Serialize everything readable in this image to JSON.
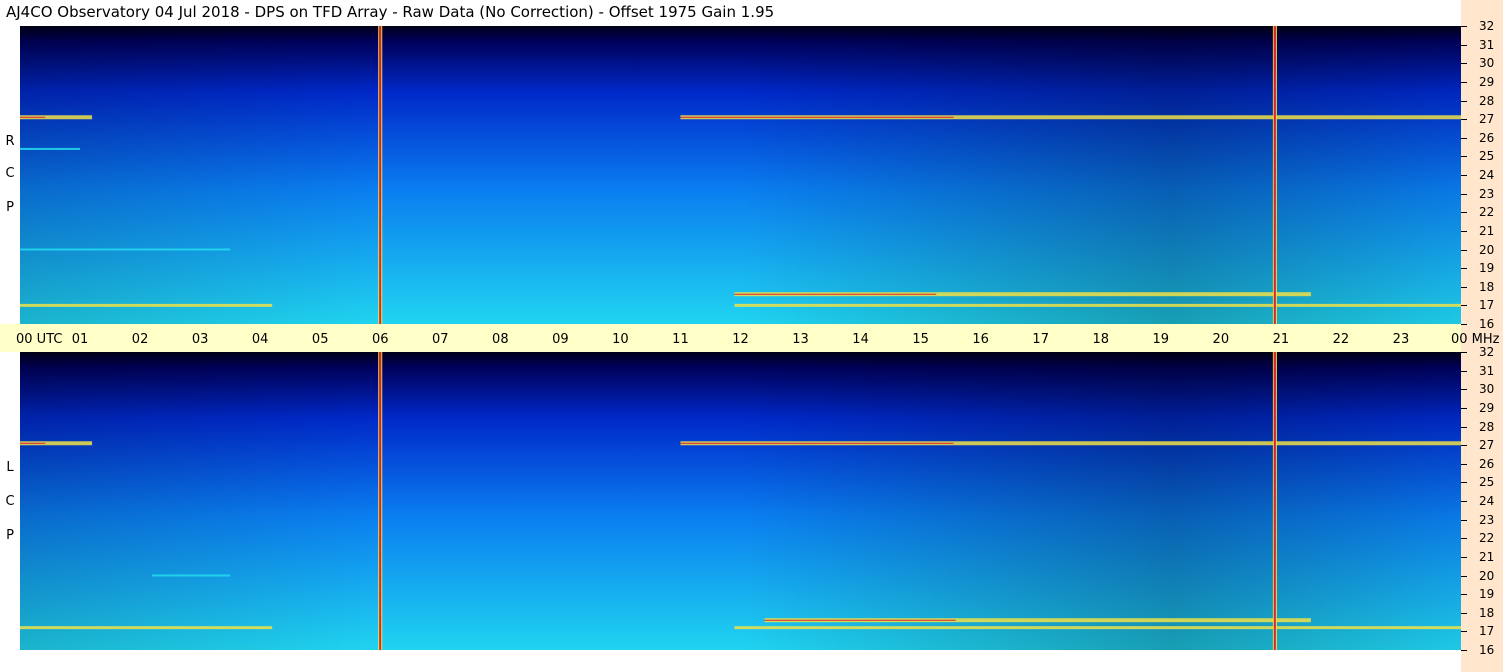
{
  "title": "AJ4CO Observatory  04 Jul 2018  -  DPS on TFD Array  -  Raw Data (No Correction)  -  Offset 1975  Gain 1.95",
  "panels": {
    "top_label": [
      "R",
      "C",
      "P"
    ],
    "bottom_label": [
      "L",
      "C",
      "P"
    ]
  },
  "x_axis": {
    "labels": [
      "00 UTC",
      "01",
      "02",
      "03",
      "04",
      "05",
      "06",
      "07",
      "08",
      "09",
      "10",
      "11",
      "12",
      "13",
      "14",
      "15",
      "16",
      "17",
      "18",
      "19",
      "20",
      "21",
      "22",
      "23",
      "00 MHz"
    ]
  },
  "y_axis": {
    "labels": [
      "32",
      "31",
      "30",
      "29",
      "28",
      "27",
      "26",
      "25",
      "24",
      "23",
      "22",
      "21",
      "20",
      "19",
      "18",
      "17",
      "16"
    ]
  },
  "chart_data": [
    {
      "type": "heatmap",
      "title": "RCP",
      "xlabel": "UTC",
      "ylabel": "MHz",
      "xlim": [
        0,
        24
      ],
      "ylim": [
        16,
        32
      ],
      "vertical_interference_lines_utc": [
        6.0,
        20.9
      ],
      "horizontal_bands_mhz": [
        {
          "freq": 27.1,
          "utc_ranges": [
            [
              0,
              1.2
            ],
            [
              11,
              24
            ]
          ],
          "intensity": "high"
        },
        {
          "freq": 17.6,
          "utc_ranges": [
            [
              11.9,
              21.5
            ]
          ],
          "intensity": "high"
        },
        {
          "freq": 17.0,
          "utc_ranges": [
            [
              0,
              4.2
            ],
            [
              11.9,
              24
            ]
          ],
          "intensity": "medium"
        },
        {
          "freq": 20.0,
          "utc_ranges": [
            [
              0,
              3.5
            ]
          ],
          "intensity": "low"
        },
        {
          "freq": 25.4,
          "utc_ranges": [
            [
              0,
              1.0
            ]
          ],
          "intensity": "low"
        }
      ]
    },
    {
      "type": "heatmap",
      "title": "LCP",
      "xlabel": "UTC",
      "ylabel": "MHz",
      "xlim": [
        0,
        24
      ],
      "ylim": [
        16,
        32
      ],
      "vertical_interference_lines_utc": [
        6.0,
        20.9
      ],
      "horizontal_bands_mhz": [
        {
          "freq": 27.1,
          "utc_ranges": [
            [
              0,
              1.2
            ],
            [
              11,
              24
            ]
          ],
          "intensity": "high"
        },
        {
          "freq": 17.6,
          "utc_ranges": [
            [
              12.4,
              21.5
            ]
          ],
          "intensity": "high"
        },
        {
          "freq": 17.2,
          "utc_ranges": [
            [
              0,
              4.2
            ],
            [
              11.9,
              24
            ]
          ],
          "intensity": "medium"
        },
        {
          "freq": 20.0,
          "utc_ranges": [
            [
              2.2,
              3.5
            ]
          ],
          "intensity": "low"
        }
      ]
    }
  ],
  "colors": {
    "noise_low": "#0000c8",
    "noise_mid": "#0a6ef0",
    "noise_high": "#22d8f0",
    "band_hot": "#f0e048",
    "band_peak": "#e02030",
    "axis_bg": "#ffffc8",
    "strip_bg": "#ffe6cc"
  }
}
